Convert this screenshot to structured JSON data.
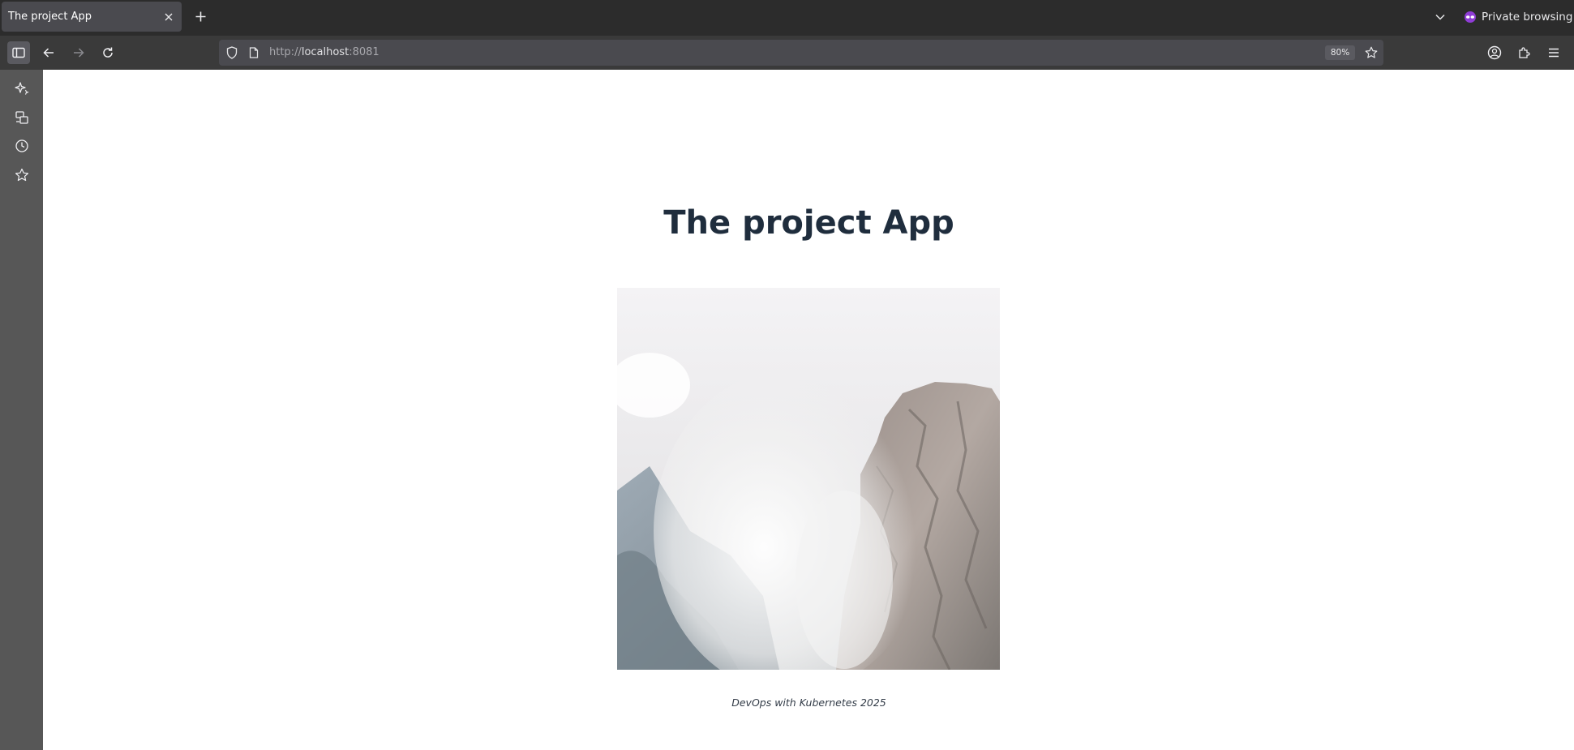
{
  "browser": {
    "tab": {
      "title": "The project App"
    },
    "private_label": "Private browsing",
    "url": {
      "protocol": "http://",
      "host": "localhost",
      "port": ":8081"
    },
    "zoom": "80%"
  },
  "icons": {
    "sidebar_toggle": "sidebar-icon",
    "back": "arrow-left-icon",
    "forward": "arrow-right-icon",
    "reload": "reload-icon",
    "shield": "shield-icon",
    "page": "page-icon",
    "bookmark": "star-icon",
    "account": "account-icon",
    "extensions": "puzzle-icon",
    "menu": "hamburger-icon",
    "sidebar_items": [
      "ai-chat-icon",
      "synced-tabs-icon",
      "history-icon",
      "bookmarks-icon"
    ]
  },
  "page": {
    "title": "The project App",
    "footer": "DevOps with Kubernetes 2025"
  },
  "colors": {
    "title": "#1f2d3d",
    "chrome_dark": "#2c2c2c",
    "toolbar": "#3a3a3a",
    "sidebar": "#575757"
  }
}
